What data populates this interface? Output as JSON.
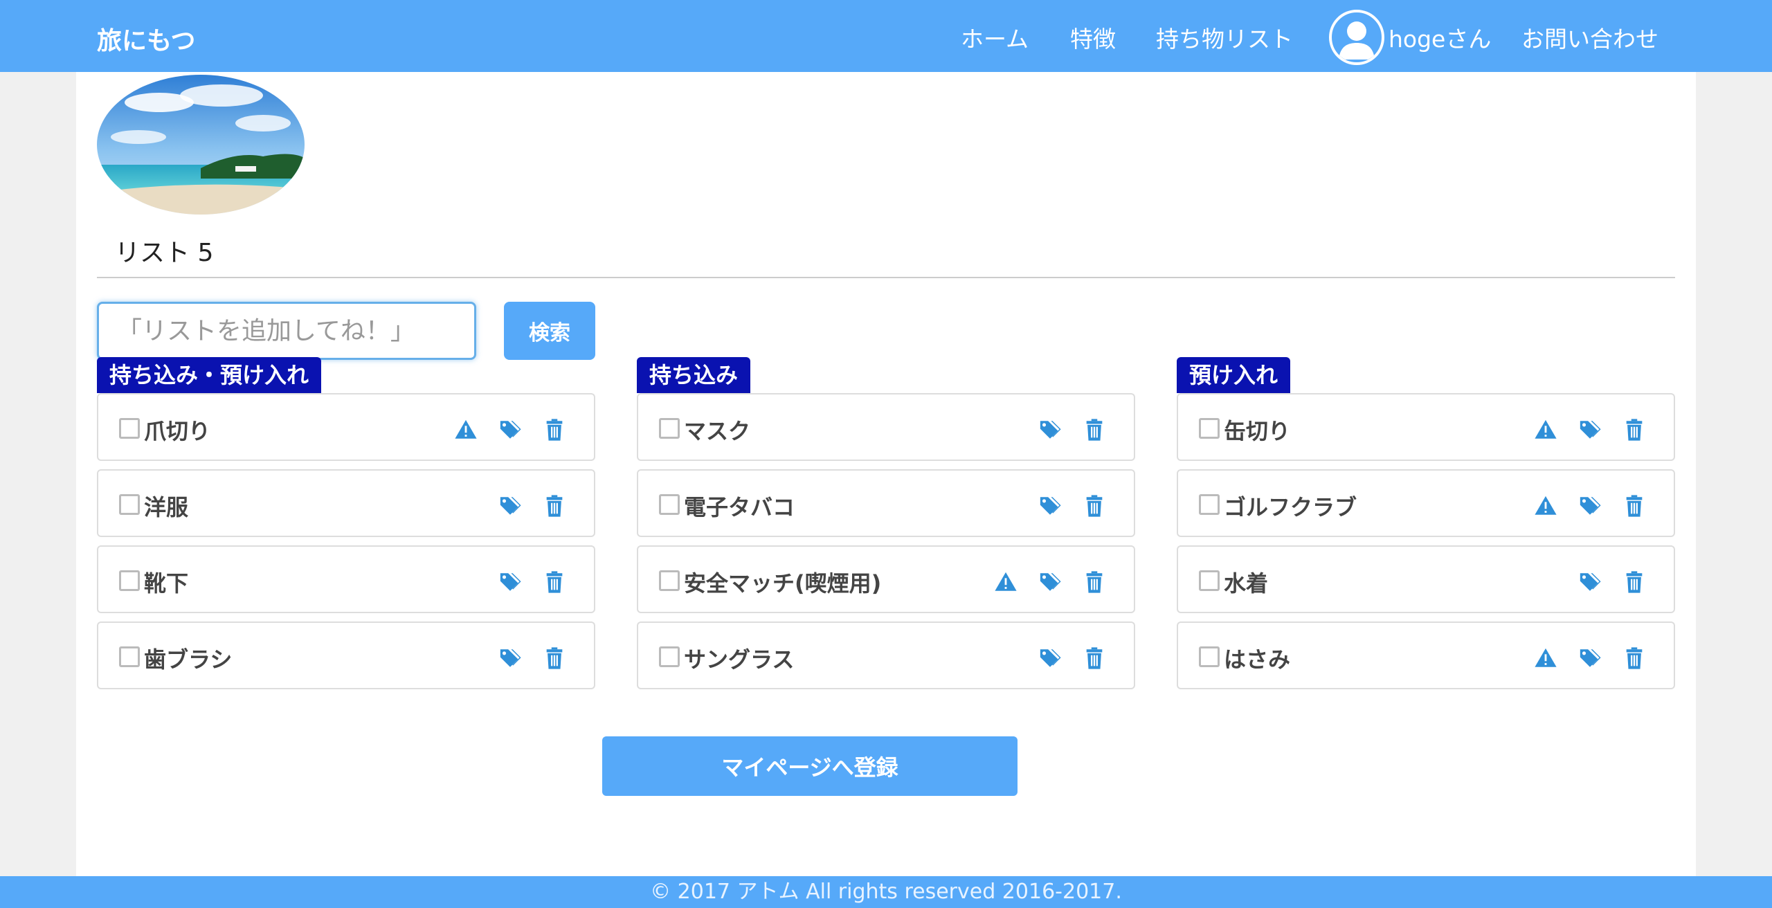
{
  "brand": "旅にもつ",
  "nav": {
    "home": "ホーム",
    "features": "特徴",
    "packing_list": "持ち物リスト",
    "user": "hogeさん",
    "contact": "お問い合わせ"
  },
  "list_title": "リスト 5",
  "search": {
    "placeholder": "「リストを追加してね！」",
    "button": "検索"
  },
  "columns": [
    {
      "tag": "持ち込み・預け入れ",
      "items": [
        {
          "label": "爪切り",
          "warning": true
        },
        {
          "label": "洋服",
          "warning": false
        },
        {
          "label": "靴下",
          "warning": false
        },
        {
          "label": "歯ブラシ",
          "warning": false
        }
      ]
    },
    {
      "tag": "持ち込み",
      "items": [
        {
          "label": "マスク",
          "warning": false
        },
        {
          "label": "電子タバコ",
          "warning": false
        },
        {
          "label": "安全マッチ(喫煙用)",
          "warning": true
        },
        {
          "label": "サングラス",
          "warning": false
        }
      ]
    },
    {
      "tag": "預け入れ",
      "items": [
        {
          "label": "缶切り",
          "warning": true
        },
        {
          "label": "ゴルフクラブ",
          "warning": true
        },
        {
          "label": "水着",
          "warning": false
        },
        {
          "label": "はさみ",
          "warning": true
        }
      ]
    }
  ],
  "register_button": "マイページへ登録",
  "footer": "© 2017 アトム All rights reserved 2016-2017.",
  "colors": {
    "primary": "#56a9f9",
    "tag_bg": "#0a12b0",
    "icon": "#2f8fd8"
  },
  "icons": [
    "user-icon",
    "warning-icon",
    "tag-icon",
    "trash-icon",
    "checkbox-icon"
  ]
}
